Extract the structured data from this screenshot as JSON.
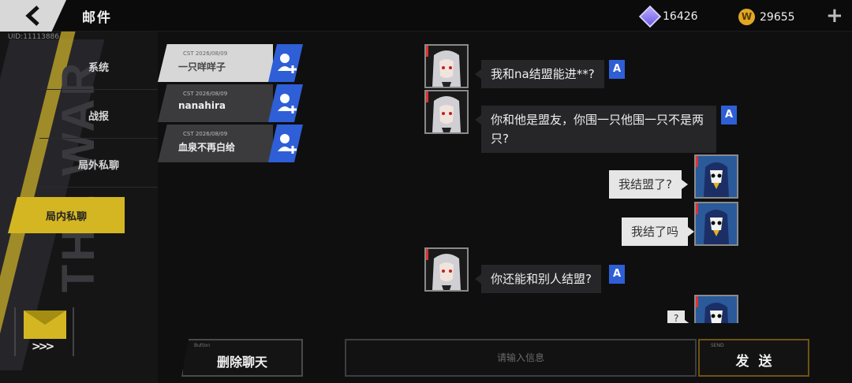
{
  "header": {
    "title": "邮件",
    "uid": "UID:11113886",
    "currency": [
      {
        "icon": "gem-icon",
        "value": "16426"
      },
      {
        "icon": "coin-icon",
        "value": "29655",
        "glyph": "W"
      }
    ],
    "plus_glyph": "+"
  },
  "sidebar": {
    "deco_text": "THE WAR",
    "items": [
      {
        "label": "系统"
      },
      {
        "label": "战报"
      },
      {
        "label": "局外私聊"
      },
      {
        "label": "局内私聊"
      }
    ]
  },
  "conversations": [
    {
      "date": "CST 2026/08/09",
      "name": "一只咩咩子"
    },
    {
      "date": "CST 2026/08/09",
      "name": "nanahira"
    },
    {
      "date": "CST 2026/08/09",
      "name": "血泉不再白给"
    }
  ],
  "messages": [
    {
      "side": "left",
      "text": "我和na结盟能进**?"
    },
    {
      "side": "left",
      "text": "你和他是盟友，你围一只他围一只不是两只?"
    },
    {
      "side": "right",
      "text": "我结盟了?"
    },
    {
      "side": "right",
      "text": "我结了吗"
    },
    {
      "side": "left",
      "text": "你还能和别人结盟?"
    },
    {
      "side": "right",
      "text": "?"
    }
  ],
  "translate_glyph": "A",
  "footer": {
    "delete_tag": "Button",
    "delete_label": "删除聊天",
    "input_placeholder": "请输入信息",
    "send_tag": "SEND",
    "send_label": "发送"
  },
  "colors": {
    "accent_yellow": "#d4b622",
    "accent_blue": "#2f5fd6"
  }
}
